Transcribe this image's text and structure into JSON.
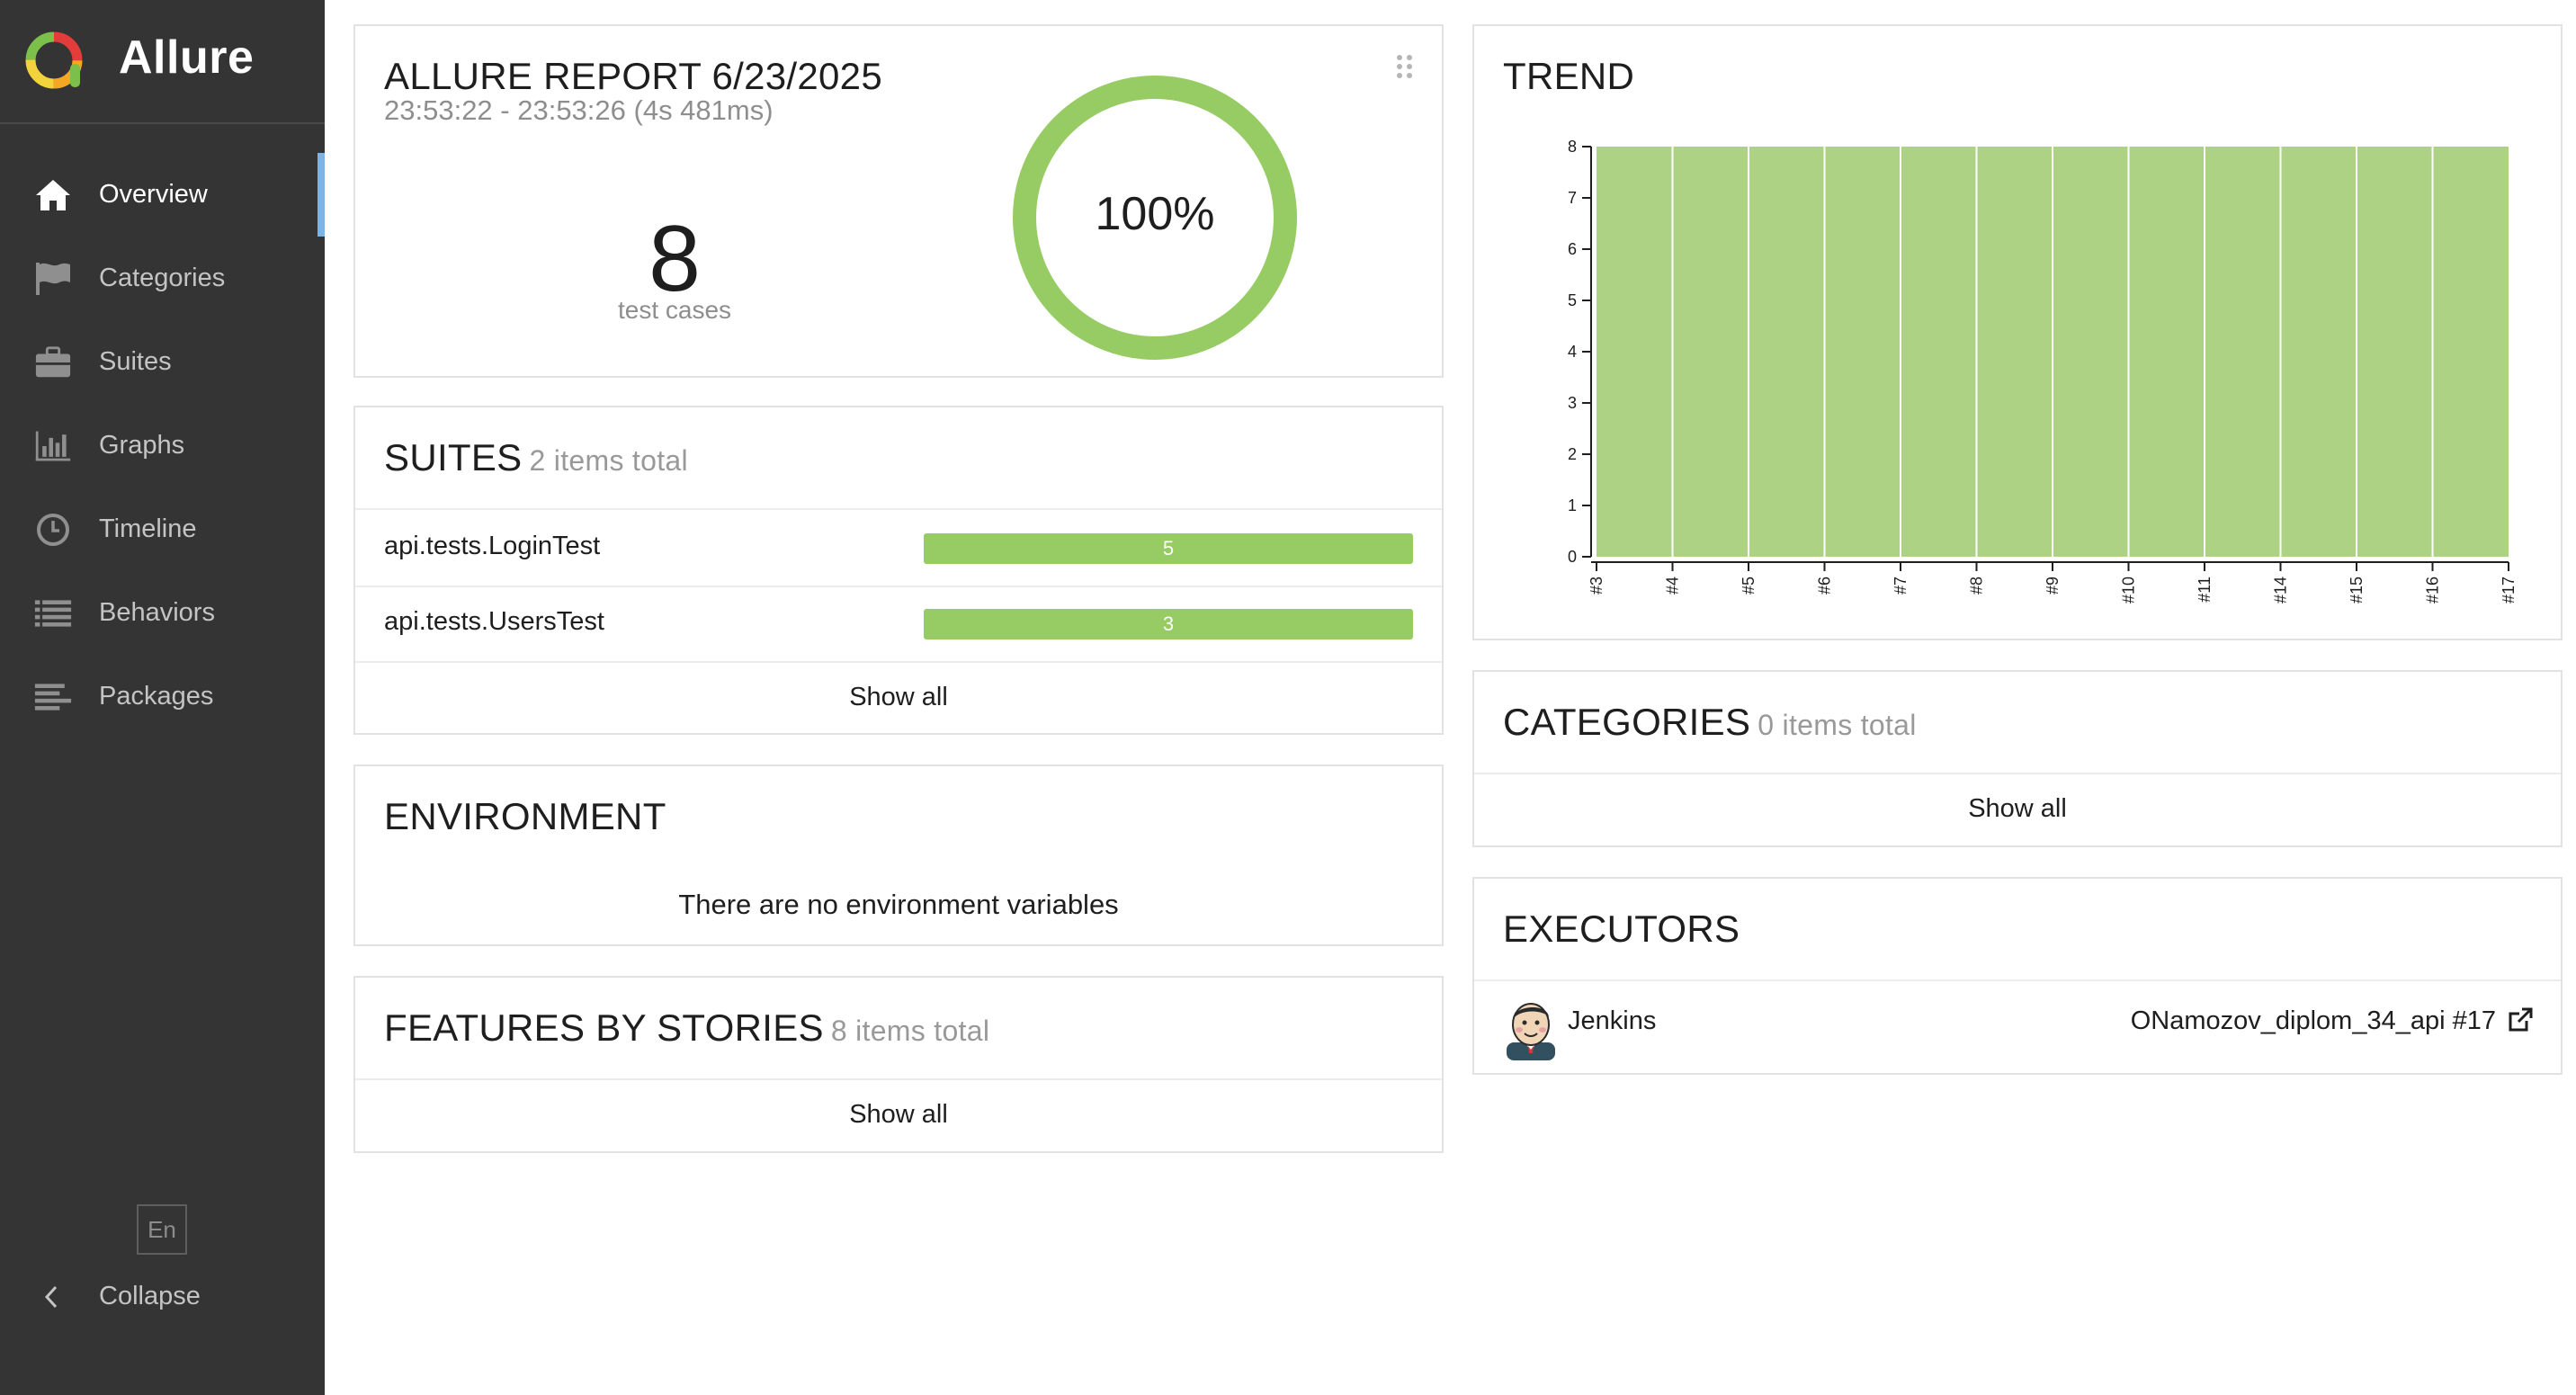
{
  "sidebar": {
    "brand": "Allure",
    "items": [
      {
        "label": "Overview",
        "icon": "home-icon",
        "active": true
      },
      {
        "label": "Categories",
        "icon": "flag-icon"
      },
      {
        "label": "Suites",
        "icon": "briefcase-icon"
      },
      {
        "label": "Graphs",
        "icon": "bar-chart-icon"
      },
      {
        "label": "Timeline",
        "icon": "clock-icon"
      },
      {
        "label": "Behaviors",
        "icon": "list-icon"
      },
      {
        "label": "Packages",
        "icon": "align-left-icon"
      }
    ],
    "language": "En",
    "collapse_label": "Collapse"
  },
  "summary": {
    "title": "ALLURE REPORT 6/23/2025",
    "time_range": "23:53:22 - 23:53:26 (4s 481ms)",
    "test_count": "8",
    "test_count_label": "test cases",
    "pass_rate": "100%",
    "pass_fraction": 1.0,
    "ring_color": "#97cc64"
  },
  "suites": {
    "title": "SUITES",
    "count": "2 items total",
    "rows": [
      {
        "name": "api.tests.LoginTest",
        "passed": "5"
      },
      {
        "name": "api.tests.UsersTest",
        "passed": "3"
      }
    ],
    "show_all": "Show all"
  },
  "environment": {
    "title": "ENVIRONMENT",
    "empty_text": "There are no environment variables"
  },
  "features": {
    "title": "FEATURES BY STORIES",
    "count": "8 items total",
    "show_all": "Show all"
  },
  "trend": {
    "title": "TREND"
  },
  "categories": {
    "title": "CATEGORIES",
    "count": "0 items total",
    "show_all": "Show all"
  },
  "executors": {
    "title": "EXECUTORS",
    "name": "Jenkins",
    "build": "ONamozov_diplom_34_api #17"
  },
  "colors": {
    "passed": "#97cc64",
    "trend_fill": "#aed283",
    "sidebar_bg": "#343434",
    "active_marker": "#7cb4e6"
  },
  "chart_data": {
    "type": "area",
    "title": "TREND",
    "x": [
      "#3",
      "#4",
      "#5",
      "#6",
      "#7",
      "#8",
      "#9",
      "#10",
      "#11",
      "#14",
      "#15",
      "#16",
      "#17"
    ],
    "series": [
      {
        "values": [
          8,
          8,
          8,
          8,
          8,
          8,
          8,
          8,
          8,
          8,
          8,
          8,
          8
        ]
      }
    ],
    "yticks": [
      "0",
      "1",
      "2",
      "3",
      "4",
      "5",
      "6",
      "7",
      "8"
    ],
    "ylim": [
      0,
      8
    ],
    "grid": false
  }
}
